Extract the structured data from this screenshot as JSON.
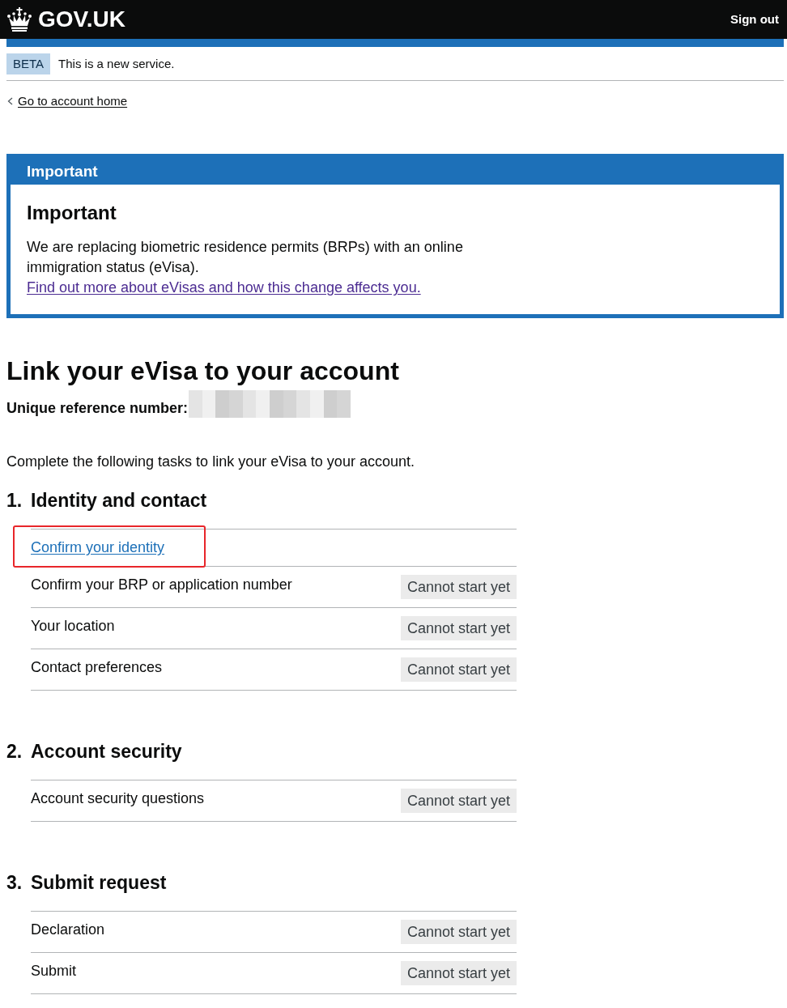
{
  "header": {
    "logo_text": "GOV.UK",
    "sign_out": "Sign out"
  },
  "phase_banner": {
    "tag": "BETA",
    "text": "This is a new service."
  },
  "back_link": "Go to account home",
  "notification": {
    "title": "Important",
    "heading": "Important",
    "body": "We are replacing biometric residence permits (BRPs) with an online immigration status (eVisa).",
    "link": {
      "text": "Find out more about eVisas and how this change affects you.",
      "visited": true
    }
  },
  "page": {
    "title": "Link your eVisa to your account",
    "reference": {
      "label": "Unique reference number:",
      "redacted": true
    },
    "intro": "Complete the following tasks to link your eVisa to your account."
  },
  "sections": [
    {
      "number": "1.",
      "title": "Identity and contact",
      "tasks": [
        {
          "name": "Confirm your identity",
          "kind": "link",
          "highlighted": true
        },
        {
          "name": "Confirm your BRP or application number",
          "kind": "text",
          "status": "Cannot start yet",
          "highlighted": false
        },
        {
          "name": "Your location",
          "kind": "text",
          "status": "Cannot start yet",
          "highlighted": false
        },
        {
          "name": "Contact preferences",
          "kind": "text",
          "status": "Cannot start yet",
          "highlighted": false
        }
      ]
    },
    {
      "number": "2.",
      "title": "Account security",
      "tasks": [
        {
          "name": "Account security questions",
          "kind": "text",
          "status": "Cannot start yet",
          "highlighted": false
        }
      ]
    },
    {
      "number": "3.",
      "title": "Submit request",
      "tasks": [
        {
          "name": "Declaration",
          "kind": "text",
          "status": "Cannot start yet",
          "highlighted": false
        },
        {
          "name": "Submit",
          "kind": "text",
          "status": "Cannot start yet",
          "highlighted": false
        }
      ]
    }
  ]
}
